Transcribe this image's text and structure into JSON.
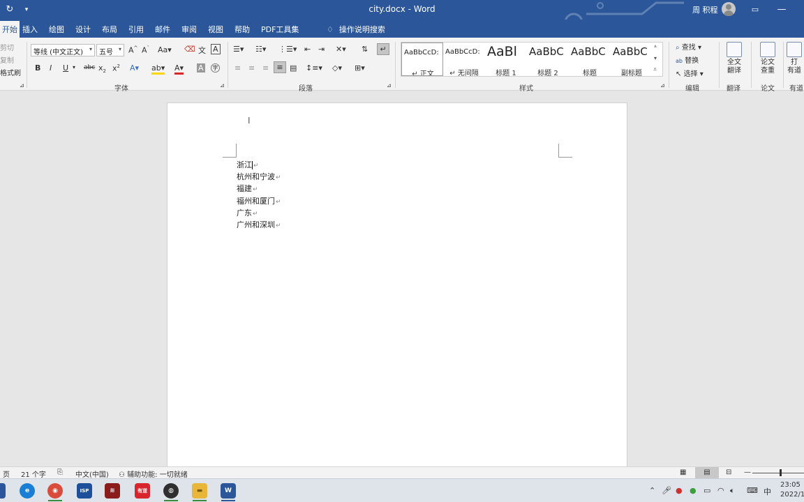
{
  "window": {
    "title": "city.docx  -  Word",
    "user": "周 积程",
    "qat_more": "▾"
  },
  "tabs": [
    {
      "label": "开始",
      "active": true
    },
    {
      "label": "插入"
    },
    {
      "label": "绘图"
    },
    {
      "label": "设计"
    },
    {
      "label": "布局"
    },
    {
      "label": "引用"
    },
    {
      "label": "邮件"
    },
    {
      "label": "审阅"
    },
    {
      "label": "视图"
    },
    {
      "label": "帮助"
    },
    {
      "label": "PDF工具集"
    }
  ],
  "search_tab": "操作说明搜索",
  "ribbon": {
    "clipboard": {
      "cut": "剪切",
      "copy": "复制",
      "format_painter": "格式刷"
    },
    "font": {
      "name": "等线 (中文正文)",
      "size": "五号",
      "group_label": "字体"
    },
    "paragraph": {
      "group_label": "段落"
    },
    "styles": {
      "group_label": "样式",
      "items": [
        {
          "sample": "AaBbCcD:",
          "name": "↵ 正文"
        },
        {
          "sample": "AaBbCcD:",
          "name": "↵ 无间隔"
        },
        {
          "sample": "AaBl",
          "name": "标题 1"
        },
        {
          "sample": "AaBbC",
          "name": "标题 2"
        },
        {
          "sample": "AaBbC",
          "name": "标题"
        },
        {
          "sample": "AaBbC",
          "name": "副标题"
        }
      ]
    },
    "editing": {
      "find": "查找",
      "replace": "替换",
      "select": "选择",
      "group_label": "编辑"
    },
    "translate": {
      "button": "全文\n翻译",
      "group_label": "翻译"
    },
    "paper": {
      "button": "论文\n查重",
      "group_label": "论文"
    },
    "youdao": {
      "button": "打\n有道",
      "group_label": "有道"
    }
  },
  "document": {
    "lines": [
      "浙江",
      "杭州和宁波",
      "福建",
      "福州和厦门",
      "广东",
      "广州和深圳"
    ],
    "paragraph_mark": "↵",
    "cursor_glyph": "I"
  },
  "statusbar": {
    "page": "页",
    "word_count": "21 个字",
    "language": "中文(中国)",
    "accessibility": "辅助功能: 一切就绪"
  },
  "taskbar": {
    "apps": [
      {
        "name": "edge",
        "color": "#1a7fd4",
        "glyph": "e"
      },
      {
        "name": "chrome",
        "color": "#d94c3c",
        "glyph": "◉"
      },
      {
        "name": "cnki",
        "color": "#1d4f9a",
        "glyph": "ISP"
      },
      {
        "name": "wolfram",
        "color": "#8a1c1c",
        "glyph": "≋"
      },
      {
        "name": "youdao",
        "color": "#d8262c",
        "glyph": "有道"
      },
      {
        "name": "obs",
        "color": "#2f2f2f",
        "glyph": "◍"
      },
      {
        "name": "file-explorer",
        "color": "#e8b73a",
        "glyph": "▬"
      },
      {
        "name": "word",
        "color": "#2b579a",
        "glyph": "W"
      }
    ],
    "ime": "中",
    "time": "23:05",
    "date": "2022/1"
  }
}
